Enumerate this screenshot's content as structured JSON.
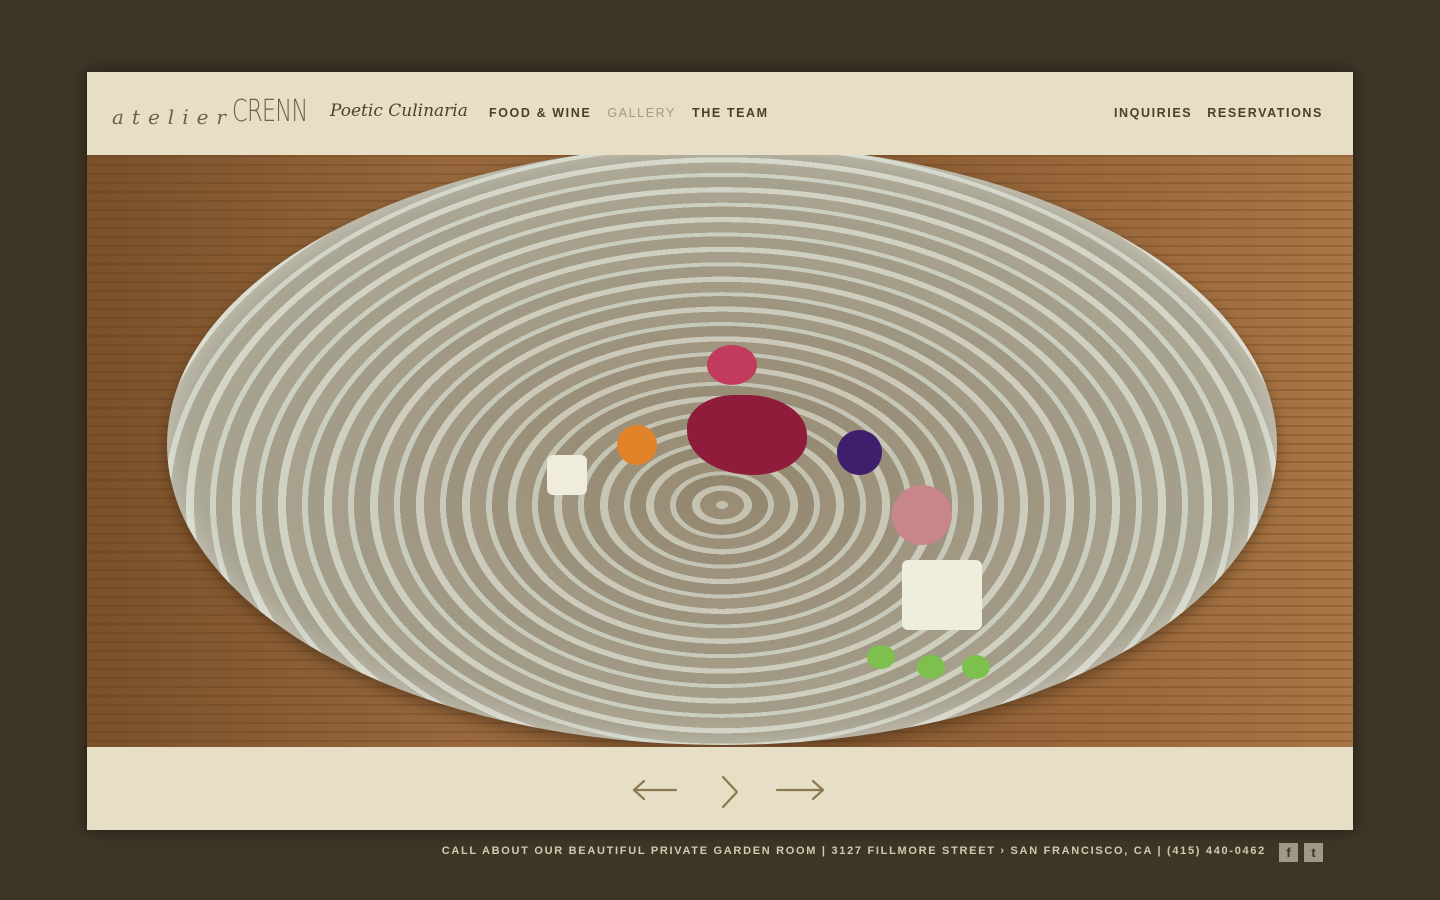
{
  "brand": {
    "logo_atelier": "atelier",
    "logo_crenn": "CRENN",
    "tagline": "Poetic Culinaria"
  },
  "nav": {
    "left": [
      {
        "label": "FOOD & WINE",
        "active": false
      },
      {
        "label": "GALLERY",
        "active": true
      },
      {
        "label": "THE TEAM",
        "active": false
      }
    ],
    "right": [
      {
        "label": "INQUIRIES"
      },
      {
        "label": "RESERVATIONS"
      }
    ]
  },
  "gallery": {
    "controls": [
      "arrow-left-icon",
      "chevron-right-icon",
      "arrow-right-icon"
    ]
  },
  "footer": {
    "text": "CALL ABOUT OUR BEAUTIFUL PRIVATE GARDEN ROOM  |  3127 FILLMORE STREET › SAN FRANCISCO, CA  |  (415) 440-0462",
    "social": [
      {
        "icon": "facebook-icon",
        "glyph": "f"
      },
      {
        "icon": "twitter-icon",
        "glyph": "t"
      }
    ]
  },
  "colors": {
    "background": "#3d3526",
    "panel": "#e6dec5",
    "nav_text": "#4a3f28",
    "nav_active": "#a69a7c",
    "arrow": "#8a7a4f"
  }
}
